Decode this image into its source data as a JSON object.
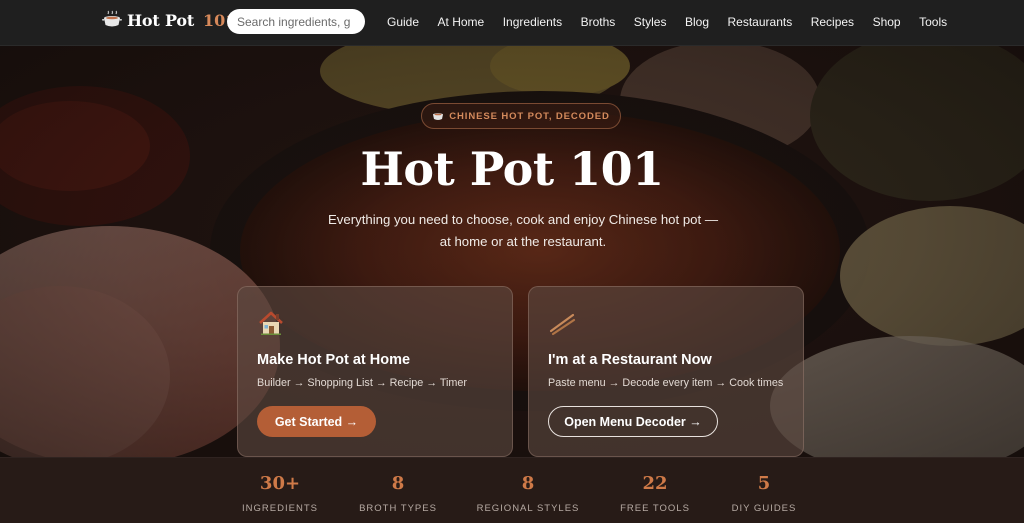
{
  "header": {
    "logo_text": "Hot Pot",
    "logo_number": "101",
    "search_placeholder": "Search ingredients, g",
    "nav": [
      "Guide",
      "At Home",
      "Ingredients",
      "Broths",
      "Styles",
      "Blog",
      "Restaurants",
      "Recipes",
      "Shop",
      "Tools"
    ]
  },
  "hero": {
    "badge": "CHINESE HOT POT, DECODED",
    "title": "Hot Pot 101",
    "subtitle": "Everything you need to choose, cook and enjoy Chinese hot pot — at home or at the restaurant."
  },
  "cards": {
    "home": {
      "icon": "house-icon",
      "title": "Make Hot Pot at Home",
      "desc": "Builder → Shopping List → Recipe → Timer",
      "button": "Get Started →"
    },
    "restaurant": {
      "icon": "chopsticks-icon",
      "title": "I'm at a Restaurant Now",
      "desc": "Paste menu → Decode every item → Cook times",
      "button": "Open Menu Decoder →"
    }
  },
  "stats": [
    {
      "value": "30+",
      "label": "INGREDIENTS"
    },
    {
      "value": "8",
      "label": "BROTH TYPES"
    },
    {
      "value": "8",
      "label": "REGIONAL STYLES"
    },
    {
      "value": "22",
      "label": "FREE TOOLS"
    },
    {
      "value": "5",
      "label": "DIY GUIDES"
    }
  ],
  "colors": {
    "accent": "#cf7a48",
    "button": "#b45e36",
    "header_bg": "#1f1f1f"
  }
}
